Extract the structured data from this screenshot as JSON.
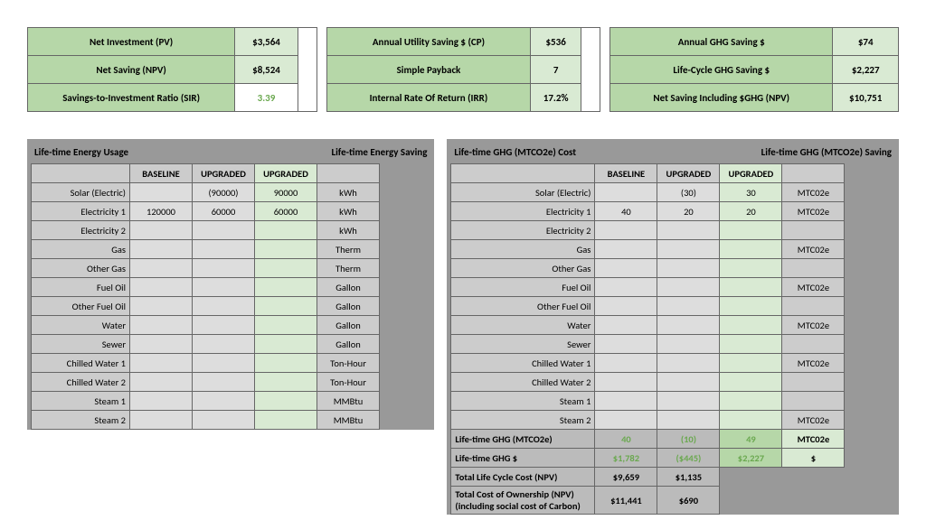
{
  "summaryA": {
    "r0": {
      "label": "Net Investment (PV)",
      "val": "$3,564"
    },
    "r1": {
      "label": "Net Saving (NPV)",
      "val": "$8,524"
    },
    "r2": {
      "label": "Savings-to-Investment Ratio (SIR)",
      "val": "3.39"
    }
  },
  "summaryB": {
    "r0": {
      "label": "Annual Utility Saving $ (CP)",
      "val": "$536"
    },
    "r1": {
      "label": "Simple Payback",
      "val": "7"
    },
    "r2": {
      "label": "Internal Rate Of Return (IRR)",
      "val": "17.2%"
    }
  },
  "summaryC": {
    "r0": {
      "label": "Annual GHG Saving $",
      "val": "$74"
    },
    "r1": {
      "label": "Life-Cycle GHG Saving $",
      "val": "$2,227"
    },
    "r2": {
      "label": "Net Saving Including $GHG (NPV)",
      "val": "$10,751"
    }
  },
  "energy": {
    "titleLeft": "Life-time Energy Usage",
    "titleRight": "Life-time Energy Saving",
    "headers": {
      "c0": "",
      "c1": "BASELINE",
      "c2": "UPGRADED",
      "c3": "UPGRADED",
      "c4": ""
    },
    "rows": [
      {
        "label": "Solar (Electric)",
        "b": "",
        "u": "(90000)",
        "s": "90000",
        "unit": "kWh"
      },
      {
        "label": "Electricity 1",
        "b": "120000",
        "u": "60000",
        "s": "60000",
        "unit": "kWh"
      },
      {
        "label": "Electricity 2",
        "b": "",
        "u": "",
        "s": "",
        "unit": "kWh"
      },
      {
        "label": "Gas",
        "b": "",
        "u": "",
        "s": "",
        "unit": "Therm"
      },
      {
        "label": "Other Gas",
        "b": "",
        "u": "",
        "s": "",
        "unit": "Therm"
      },
      {
        "label": "Fuel Oil",
        "b": "",
        "u": "",
        "s": "",
        "unit": "Gallon"
      },
      {
        "label": "Other Fuel Oil",
        "b": "",
        "u": "",
        "s": "",
        "unit": "Gallon"
      },
      {
        "label": "Water",
        "b": "",
        "u": "",
        "s": "",
        "unit": "Gallon"
      },
      {
        "label": "Sewer",
        "b": "",
        "u": "",
        "s": "",
        "unit": "Gallon"
      },
      {
        "label": "Chilled Water 1",
        "b": "",
        "u": "",
        "s": "",
        "unit": "Ton-Hour"
      },
      {
        "label": "Chilled Water 2",
        "b": "",
        "u": "",
        "s": "",
        "unit": "Ton-Hour"
      },
      {
        "label": "Steam 1",
        "b": "",
        "u": "",
        "s": "",
        "unit": "MMBtu"
      },
      {
        "label": "Steam 2",
        "b": "",
        "u": "",
        "s": "",
        "unit": "MMBtu"
      }
    ]
  },
  "ghg": {
    "titleLeft": "Life-time GHG (MTCO2e) Cost",
    "titleRight": "Life-time GHG (MTCO2e) Saving",
    "headers": {
      "c0": "",
      "c1": "BASELINE",
      "c2": "UPGRADED",
      "c3": "UPGRADED",
      "c4": ""
    },
    "rows": [
      {
        "label": "Solar (Electric)",
        "b": "",
        "u": "(30)",
        "s": "30",
        "unit": "MTC02e"
      },
      {
        "label": "Electricity 1",
        "b": "40",
        "u": "20",
        "s": "20",
        "unit": "MTC02e"
      },
      {
        "label": "Electricity 2",
        "b": "",
        "u": "",
        "s": "",
        "unit": ""
      },
      {
        "label": "Gas",
        "b": "",
        "u": "",
        "s": "",
        "unit": "MTC02e"
      },
      {
        "label": "Other Gas",
        "b": "",
        "u": "",
        "s": "",
        "unit": ""
      },
      {
        "label": "Fuel Oil",
        "b": "",
        "u": "",
        "s": "",
        "unit": "MTC02e"
      },
      {
        "label": "Other Fuel Oil",
        "b": "",
        "u": "",
        "s": "",
        "unit": ""
      },
      {
        "label": "Water",
        "b": "",
        "u": "",
        "s": "",
        "unit": "MTC02e"
      },
      {
        "label": "Sewer",
        "b": "",
        "u": "",
        "s": "",
        "unit": ""
      },
      {
        "label": "Chilled Water 1",
        "b": "",
        "u": "",
        "s": "",
        "unit": "MTC02e"
      },
      {
        "label": "Chilled Water 2",
        "b": "",
        "u": "",
        "s": "",
        "unit": ""
      },
      {
        "label": "Steam 1",
        "b": "",
        "u": "",
        "s": "",
        "unit": ""
      },
      {
        "label": "Steam 2",
        "b": "",
        "u": "",
        "s": "",
        "unit": "MTC02e"
      }
    ],
    "footers": {
      "f0": {
        "label": "Life-time GHG (MTCO2e)",
        "b": "40",
        "u": "(10)",
        "s": "49",
        "unit": "MTC02e"
      },
      "f1": {
        "label": "Life-time GHG $",
        "b": "$1,782",
        "u": "($445)",
        "s": "$2,227",
        "unit": "$"
      },
      "f2": {
        "label": "Total Life Cycle Cost (NPV)",
        "b": "$9,659",
        "u": "$1,135"
      },
      "f3": {
        "label": "Total Cost of Ownership (NPV) (including social cost of Carbon)",
        "b": "$11,441",
        "u": "$690"
      }
    }
  }
}
